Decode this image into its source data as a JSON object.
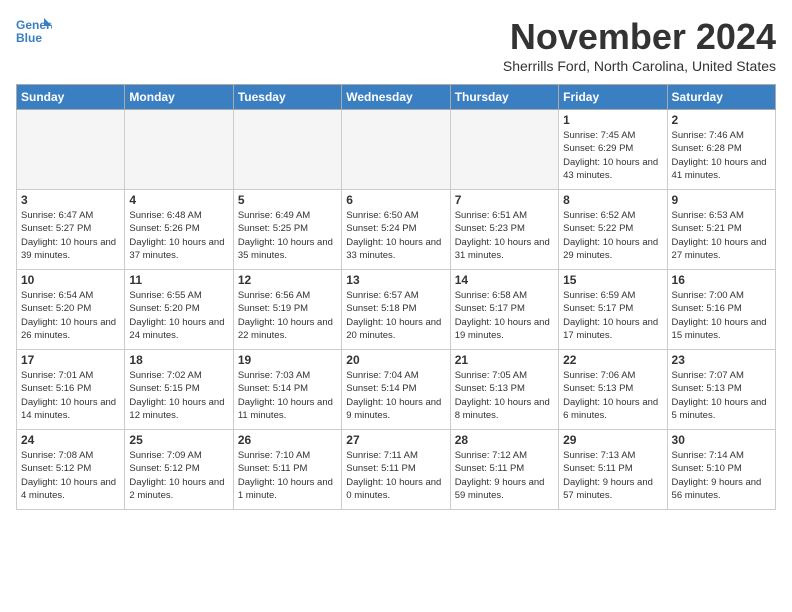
{
  "header": {
    "logo_line1": "General",
    "logo_line2": "Blue",
    "month": "November 2024",
    "location": "Sherrills Ford, North Carolina, United States"
  },
  "days_of_week": [
    "Sunday",
    "Monday",
    "Tuesday",
    "Wednesday",
    "Thursday",
    "Friday",
    "Saturday"
  ],
  "weeks": [
    [
      {
        "day": "",
        "info": ""
      },
      {
        "day": "",
        "info": ""
      },
      {
        "day": "",
        "info": ""
      },
      {
        "day": "",
        "info": ""
      },
      {
        "day": "",
        "info": ""
      },
      {
        "day": "1",
        "info": "Sunrise: 7:45 AM\nSunset: 6:29 PM\nDaylight: 10 hours and 43 minutes."
      },
      {
        "day": "2",
        "info": "Sunrise: 7:46 AM\nSunset: 6:28 PM\nDaylight: 10 hours and 41 minutes."
      }
    ],
    [
      {
        "day": "3",
        "info": "Sunrise: 6:47 AM\nSunset: 5:27 PM\nDaylight: 10 hours and 39 minutes."
      },
      {
        "day": "4",
        "info": "Sunrise: 6:48 AM\nSunset: 5:26 PM\nDaylight: 10 hours and 37 minutes."
      },
      {
        "day": "5",
        "info": "Sunrise: 6:49 AM\nSunset: 5:25 PM\nDaylight: 10 hours and 35 minutes."
      },
      {
        "day": "6",
        "info": "Sunrise: 6:50 AM\nSunset: 5:24 PM\nDaylight: 10 hours and 33 minutes."
      },
      {
        "day": "7",
        "info": "Sunrise: 6:51 AM\nSunset: 5:23 PM\nDaylight: 10 hours and 31 minutes."
      },
      {
        "day": "8",
        "info": "Sunrise: 6:52 AM\nSunset: 5:22 PM\nDaylight: 10 hours and 29 minutes."
      },
      {
        "day": "9",
        "info": "Sunrise: 6:53 AM\nSunset: 5:21 PM\nDaylight: 10 hours and 27 minutes."
      }
    ],
    [
      {
        "day": "10",
        "info": "Sunrise: 6:54 AM\nSunset: 5:20 PM\nDaylight: 10 hours and 26 minutes."
      },
      {
        "day": "11",
        "info": "Sunrise: 6:55 AM\nSunset: 5:20 PM\nDaylight: 10 hours and 24 minutes."
      },
      {
        "day": "12",
        "info": "Sunrise: 6:56 AM\nSunset: 5:19 PM\nDaylight: 10 hours and 22 minutes."
      },
      {
        "day": "13",
        "info": "Sunrise: 6:57 AM\nSunset: 5:18 PM\nDaylight: 10 hours and 20 minutes."
      },
      {
        "day": "14",
        "info": "Sunrise: 6:58 AM\nSunset: 5:17 PM\nDaylight: 10 hours and 19 minutes."
      },
      {
        "day": "15",
        "info": "Sunrise: 6:59 AM\nSunset: 5:17 PM\nDaylight: 10 hours and 17 minutes."
      },
      {
        "day": "16",
        "info": "Sunrise: 7:00 AM\nSunset: 5:16 PM\nDaylight: 10 hours and 15 minutes."
      }
    ],
    [
      {
        "day": "17",
        "info": "Sunrise: 7:01 AM\nSunset: 5:16 PM\nDaylight: 10 hours and 14 minutes."
      },
      {
        "day": "18",
        "info": "Sunrise: 7:02 AM\nSunset: 5:15 PM\nDaylight: 10 hours and 12 minutes."
      },
      {
        "day": "19",
        "info": "Sunrise: 7:03 AM\nSunset: 5:14 PM\nDaylight: 10 hours and 11 minutes."
      },
      {
        "day": "20",
        "info": "Sunrise: 7:04 AM\nSunset: 5:14 PM\nDaylight: 10 hours and 9 minutes."
      },
      {
        "day": "21",
        "info": "Sunrise: 7:05 AM\nSunset: 5:13 PM\nDaylight: 10 hours and 8 minutes."
      },
      {
        "day": "22",
        "info": "Sunrise: 7:06 AM\nSunset: 5:13 PM\nDaylight: 10 hours and 6 minutes."
      },
      {
        "day": "23",
        "info": "Sunrise: 7:07 AM\nSunset: 5:13 PM\nDaylight: 10 hours and 5 minutes."
      }
    ],
    [
      {
        "day": "24",
        "info": "Sunrise: 7:08 AM\nSunset: 5:12 PM\nDaylight: 10 hours and 4 minutes."
      },
      {
        "day": "25",
        "info": "Sunrise: 7:09 AM\nSunset: 5:12 PM\nDaylight: 10 hours and 2 minutes."
      },
      {
        "day": "26",
        "info": "Sunrise: 7:10 AM\nSunset: 5:11 PM\nDaylight: 10 hours and 1 minute."
      },
      {
        "day": "27",
        "info": "Sunrise: 7:11 AM\nSunset: 5:11 PM\nDaylight: 10 hours and 0 minutes."
      },
      {
        "day": "28",
        "info": "Sunrise: 7:12 AM\nSunset: 5:11 PM\nDaylight: 9 hours and 59 minutes."
      },
      {
        "day": "29",
        "info": "Sunrise: 7:13 AM\nSunset: 5:11 PM\nDaylight: 9 hours and 57 minutes."
      },
      {
        "day": "30",
        "info": "Sunrise: 7:14 AM\nSunset: 5:10 PM\nDaylight: 9 hours and 56 minutes."
      }
    ]
  ]
}
